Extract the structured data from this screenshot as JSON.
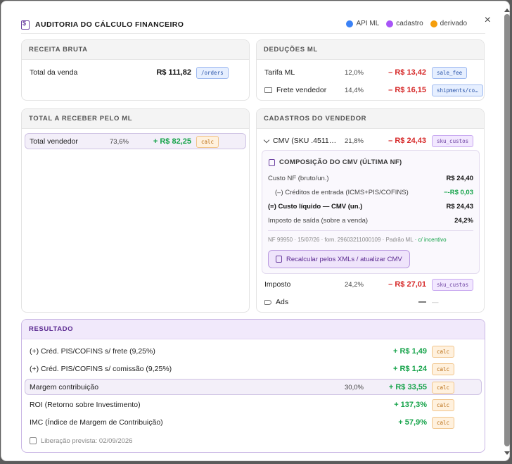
{
  "header": {
    "title": "AUDITORIA DO CÁLCULO FINANCEIRO",
    "close": "×"
  },
  "legend": [
    {
      "label": "API ML",
      "color": "#3b82f6"
    },
    {
      "label": "cadastro",
      "color": "#a855f7"
    },
    {
      "label": "derivado",
      "color": "#f59e0b"
    }
  ],
  "receita": {
    "title": "RECEITA BRUTA",
    "row": {
      "label": "Total da venda",
      "value": "R$ 111,82",
      "tag": "/orders"
    }
  },
  "deducoes": {
    "title": "DEDUÇÕES ML",
    "rows": [
      {
        "label": "Tarifa ML",
        "pct": "12,0%",
        "value": "– R$ 13,42",
        "tag": "sale_fee"
      },
      {
        "label": "Frete vendedor",
        "pct": "14,4%",
        "value": "– R$ 16,15",
        "tag": "shipments/co…"
      }
    ]
  },
  "receber": {
    "title": "TOTAL A RECEBER PELO ML",
    "row": {
      "label": "Total vendedor",
      "pct": "73,6%",
      "value": "+ R$ 82,25",
      "tag": "calc"
    }
  },
  "cadastros": {
    "title": "CADASTROS DO VENDEDOR",
    "cmv": {
      "label": "CMV (SKU .4511…",
      "pct": "21,8%",
      "value": "– R$ 24,43",
      "tag": "sku_custos"
    },
    "composicao": {
      "title": "COMPOSIÇÃO DO CMV (ÚLTIMA NF)",
      "rows": [
        {
          "label": "Custo NF (bruto/un.)",
          "value": "R$ 24,40"
        },
        {
          "label": "(–) Créditos de entrada (ICMS+PIS/COFINS)",
          "value": "−-R$ 0,03"
        },
        {
          "label": "(=) Custo líquido — CMV (un.)",
          "value": "R$ 24,43"
        },
        {
          "label": "Imposto de saída (sobre a venda)",
          "value": "24,2%"
        }
      ],
      "footer": "NF 99950 · 15/07/26 · forn. 29603211000109 · Padrão ML",
      "footer_incentivo": "· c/ incentivo",
      "button": "Recalcular pelos XMLs / atualizar CMV"
    },
    "imposto": {
      "label": "Imposto",
      "pct": "24,2%",
      "value": "– R$ 27,01",
      "tag": "sku_custos"
    },
    "ads": {
      "label": "Ads",
      "value": "—",
      "extra": "—"
    }
  },
  "resultado": {
    "title": "RESULTADO",
    "rows": [
      {
        "label": "(+) Créd. PIS/COFINS s/ frete (9,25%)",
        "pct": "",
        "value": "+ R$ 1,49",
        "tag": "calc"
      },
      {
        "label": "(+) Créd. PIS/COFINS s/ comissão (9,25%)",
        "pct": "",
        "value": "+ R$ 1,24",
        "tag": "calc"
      },
      {
        "label": "Margem contribuição",
        "pct": "30,0%",
        "value": "+ R$ 33,55",
        "tag": "calc"
      },
      {
        "label": "ROI (Retorno sobre Investimento)",
        "pct": "",
        "value": "+ 137,3%",
        "tag": "calc"
      },
      {
        "label": "IMC (Índice de Margem de Contribuição)",
        "pct": "",
        "value": "+ 57,9%",
        "tag": "calc"
      }
    ],
    "liberacao": "Liberação prevista: 02/09/2026"
  }
}
